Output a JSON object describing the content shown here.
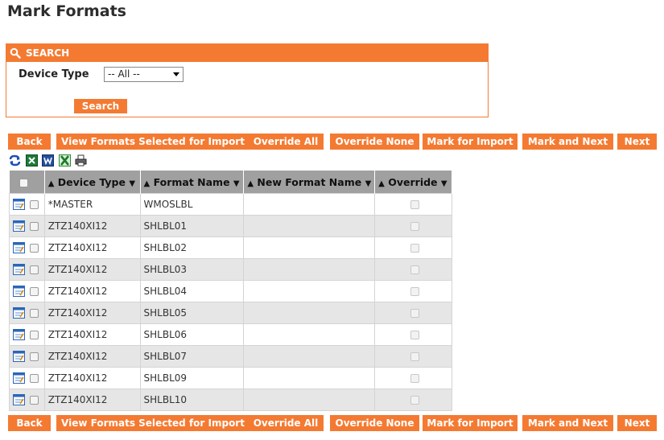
{
  "page": {
    "title": "Mark Formats"
  },
  "search": {
    "header": "SEARCH",
    "device_type_label": "Device Type",
    "device_type_value": "-- All --",
    "search_button": "Search"
  },
  "actions": {
    "back": "Back",
    "view_selected": "View Formats Selected for Import",
    "override_all": "Override All",
    "override_none": "Override None",
    "mark_for_import": "Mark for Import",
    "mark_and_next": "Mark and Next",
    "next": "Next"
  },
  "export_icons": [
    "refresh-icon",
    "excel-icon",
    "word-icon",
    "excel-export-icon",
    "print-icon"
  ],
  "table": {
    "columns": {
      "device_type": "Device Type",
      "format_name": "Format Name",
      "new_format_name": "New Format Name",
      "override": "Override"
    },
    "sort_up": "▲",
    "sort_down": "▼",
    "rows": [
      {
        "device_type": "*MASTER",
        "format_name": "WMOSLBL",
        "new_format_name": ""
      },
      {
        "device_type": "ZTZ140XI12",
        "format_name": "SHLBL01",
        "new_format_name": ""
      },
      {
        "device_type": "ZTZ140XI12",
        "format_name": "SHLBL02",
        "new_format_name": ""
      },
      {
        "device_type": "ZTZ140XI12",
        "format_name": "SHLBL03",
        "new_format_name": ""
      },
      {
        "device_type": "ZTZ140XI12",
        "format_name": "SHLBL04",
        "new_format_name": ""
      },
      {
        "device_type": "ZTZ140XI12",
        "format_name": "SHLBL05",
        "new_format_name": ""
      },
      {
        "device_type": "ZTZ140XI12",
        "format_name": "SHLBL06",
        "new_format_name": ""
      },
      {
        "device_type": "ZTZ140XI12",
        "format_name": "SHLBL07",
        "new_format_name": ""
      },
      {
        "device_type": "ZTZ140XI12",
        "format_name": "SHLBL09",
        "new_format_name": ""
      },
      {
        "device_type": "ZTZ140XI12",
        "format_name": "SHLBL10",
        "new_format_name": ""
      }
    ]
  },
  "colors": {
    "accent": "#f47a32",
    "header_bg": "#a0a0a0",
    "alt_row": "#e6e6e6"
  }
}
